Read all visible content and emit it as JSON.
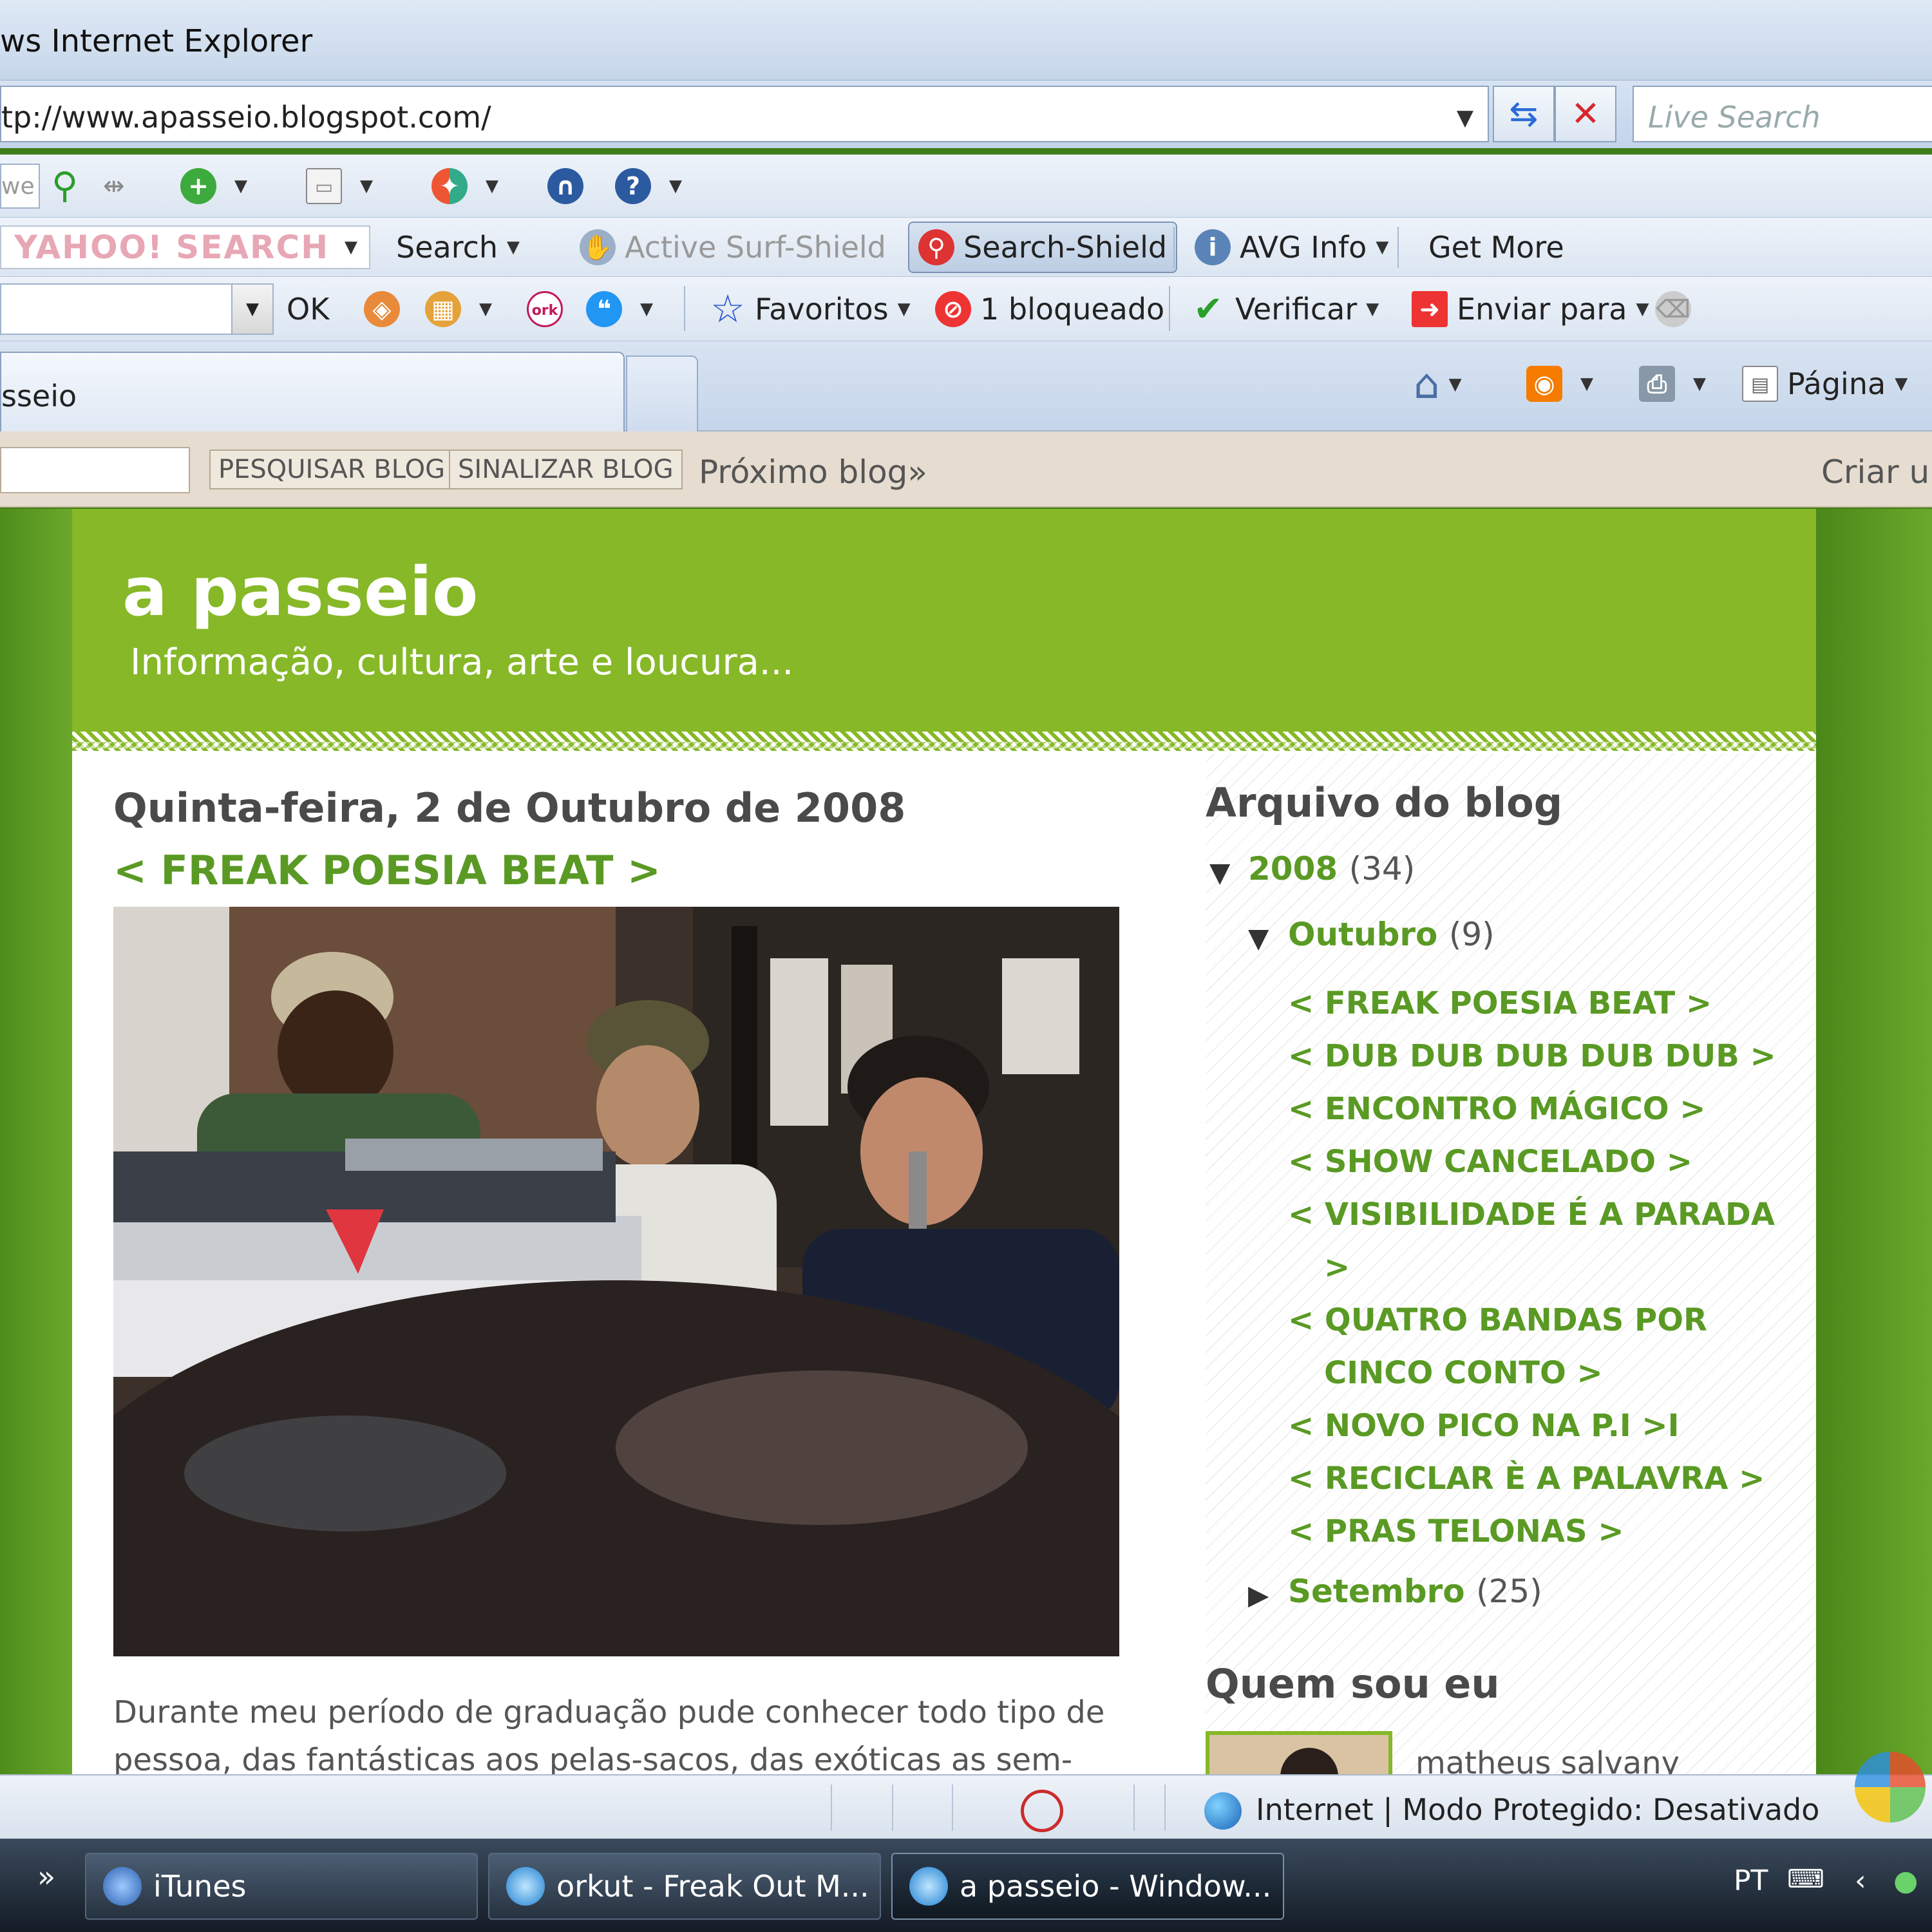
{
  "window": {
    "title": "ws Internet Explorer"
  },
  "address": {
    "url": "tp://www.apasseio.blogspot.com/",
    "search_placeholder": "Live Search"
  },
  "toolbar1": {
    "search_stub": "we"
  },
  "toolbar2": {
    "yahoo_logo": "YAHOO! SEARCH",
    "search": "Search",
    "active_surf_shield": "Active Surf-Shield",
    "search_shield": "Search-Shield",
    "avg_info": "AVG Info",
    "get_more": "Get More"
  },
  "toolbar3": {
    "ok": "OK",
    "favoritos": "Favoritos",
    "bloqueado": "1 bloqueado",
    "verificar": "Verificar",
    "enviar_para": "Enviar para"
  },
  "tabs": {
    "active_label": "sseio",
    "pagina": "Página"
  },
  "blogger_nav": {
    "pesquisar": "PESQUISAR BLOG",
    "sinalizar": "SINALIZAR BLOG",
    "proximo": "Próximo blog»",
    "criar": "Criar ur"
  },
  "blog": {
    "title": "a passeio",
    "description": "Informação, cultura, arte e loucura...",
    "post": {
      "date": "Quinta-feira, 2 de Outubro de 2008",
      "title": "< FREAK POESIA BEAT >",
      "body_line1": "Durante meu período de graduação pude conhecer todo tipo de",
      "body_line2": "pessoa, das fantásticas aos pelas-sacos, das exóticas as sem-"
    },
    "sidebar": {
      "archive_heading": "Arquivo do blog",
      "year": "2008",
      "year_count": "(34)",
      "month": "Outubro",
      "month_count": "(9)",
      "posts": [
        "< FREAK POESIA BEAT >",
        "< DUB DUB DUB DUB DUB >",
        "< ENCONTRO MÁGICO >",
        "< SHOW CANCELADO >",
        "< VISIBILIDADE É A PARADA",
        ">",
        "< QUATRO BANDAS POR",
        "CINCO CONTO >",
        "< NOVO PICO NA P.I >I",
        "< RECICLAR È A PALAVRA >",
        "< PRAS TELONAS >"
      ],
      "prev_month": "Setembro",
      "prev_month_count": "(25)",
      "about_heading": "Quem sou eu",
      "profile_name": "matheus salvany"
    }
  },
  "status": {
    "zone": "Internet | Modo Protegido: Desativado"
  },
  "taskbar": {
    "overflow": "»",
    "items": [
      "iTunes",
      "orkut - Freak Out M...",
      "a passeio - Window..."
    ],
    "lang": "PT"
  }
}
